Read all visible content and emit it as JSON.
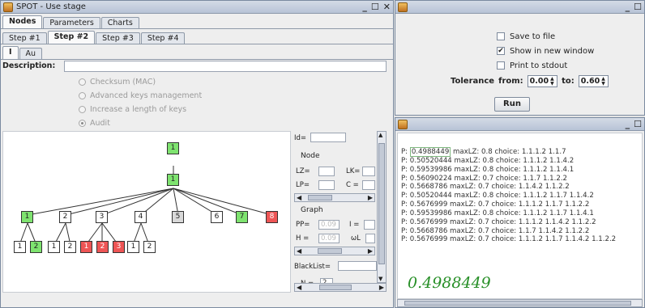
{
  "left_window": {
    "title": "SPOT - Use stage",
    "main_tabs": [
      "Nodes",
      "Parameters",
      "Charts"
    ],
    "step_tabs": [
      "Step #1",
      "Step #2",
      "Step #3",
      "Step #4"
    ],
    "sub_tabs": [
      "I",
      "Au"
    ],
    "description_label": "Description:",
    "radio_options": [
      "Checksum (MAC)",
      "Advanced keys management",
      "Increase a length of keys",
      "Audit"
    ],
    "selected_radio": "Audit",
    "tree": {
      "root": "1",
      "level1": "1",
      "level2": [
        "1",
        "2",
        "3",
        "4",
        "5",
        "6",
        "7",
        "8"
      ],
      "level3": [
        "1",
        "2",
        "1",
        "2",
        "1",
        "2",
        "3",
        "1",
        "2"
      ]
    },
    "side": {
      "id_label": "Id=",
      "node_label": "Node",
      "lz_label": "LZ=",
      "lk_label": "LK=",
      "lp_label": "LP=",
      "c_label": "C =",
      "graph_label": "Graph",
      "pp_label": "PP=",
      "pp_value": "0.09",
      "i_label": "I =",
      "h_label": "H =",
      "h_value": "0.09",
      "omega_label": "ωL",
      "blacklist_label": "BlackList=",
      "n_label": "N =",
      "n_value": "2"
    }
  },
  "right_top": {
    "save_to_file": "Save to file",
    "show_in_new_window": "Show in new window",
    "print_to_stdout": "Print to stdout",
    "tolerance_label": "Tolerance",
    "from_label": "from:",
    "from_value": "0.00",
    "to_label": "to:",
    "to_value": "0.60",
    "run_label": "Run"
  },
  "right_bottom": {
    "first_prefix": "P:",
    "first_value": "0.4988449",
    "first_rest": " maxLZ: 0.8 choice: 1.1.1.2 1.1.7",
    "lines": [
      "P: 0.50520444 maxLZ: 0.8 choice: 1.1.1.2 1.1.4.2",
      "P: 0.59539986 maxLZ: 0.8 choice: 1.1.1.2 1.1.4.1",
      "P: 0.56090224 maxLZ: 0.7 choice: 1.1.7 1.1.2.2",
      "P: 0.5668786 maxLZ: 0.7 choice: 1.1.4.2 1.1.2.2",
      "P: 0.50520444 maxLZ: 0.8 choice: 1.1.1.2 1.1.7 1.1.4.2",
      "P: 0.5676999 maxLZ: 0.7 choice: 1.1.1.2 1.1.7 1.1.2.2",
      "P: 0.59539986 maxLZ: 0.8 choice: 1.1.1.2 1.1.7 1.1.4.1",
      "P: 0.5676999 maxLZ: 0.7 choice: 1.1.1.2 1.1.4.2 1.1.2.2",
      "P: 0.5668786 maxLZ: 0.7 choice: 1.1.7 1.1.4.2 1.1.2.2",
      "P: 0.5676999 maxLZ: 0.7 choice: 1.1.1.2 1.1.7 1.1.4.2 1.1.2.2"
    ],
    "big_value": "0.4988449"
  }
}
